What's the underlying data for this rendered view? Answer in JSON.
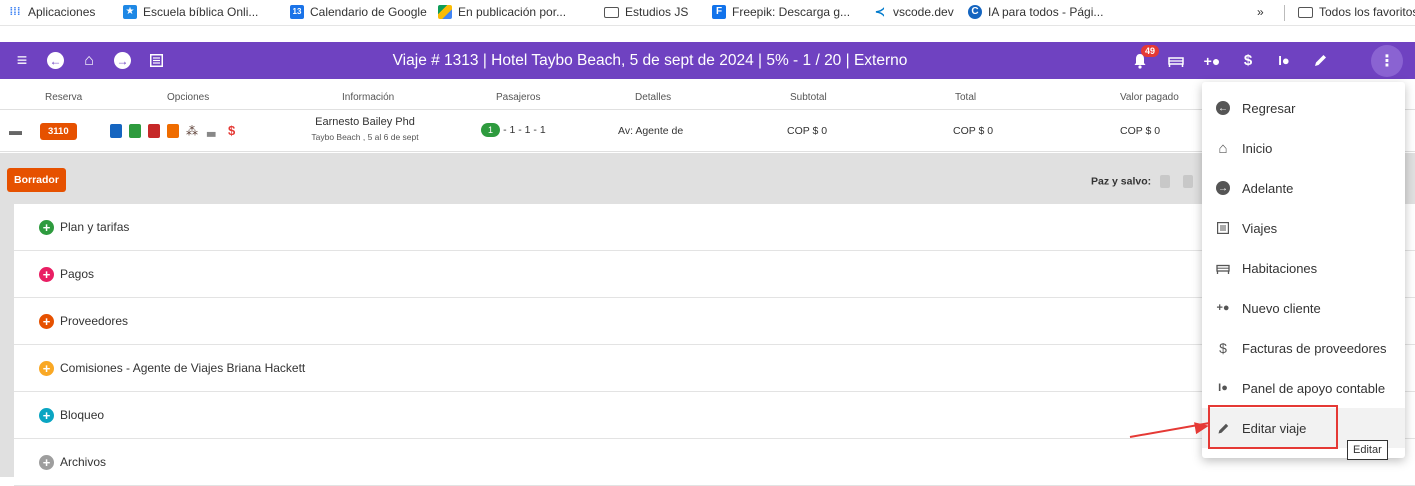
{
  "bookmarks": [
    {
      "label": "Aplicaciones",
      "icon": "apps-grid-icon",
      "color": "#4285f4"
    },
    {
      "label": "Escuela bíblica Onli...",
      "icon": "school-icon",
      "color": "#1e88e5"
    },
    {
      "label": "Calendario de Google",
      "icon": "calendar-icon",
      "color": "#1a73e8"
    },
    {
      "label": "En publicación por...",
      "icon": "drive-icon",
      "color": "#fbbc04"
    },
    {
      "label": "Estudios JS",
      "icon": "folder-icon",
      "color": "#555555"
    },
    {
      "label": "Freepik: Descarga g...",
      "icon": "freepik-icon",
      "color": "#1273eb"
    },
    {
      "label": "vscode.dev",
      "icon": "vscode-icon",
      "color": "#007acc"
    },
    {
      "label": "IA para todos - Pági...",
      "icon": "globe-icon",
      "color": "#1565c0"
    }
  ],
  "bookmarks_more": "»",
  "bookmarks_all": "Todos los favoritos",
  "appbar": {
    "title": "Viaje # 1313 | Hotel Taybo Beach, 5 de sept de 2024 | 5% - 1 / 20 | Externo",
    "notifications_count": "49",
    "bg_color": "#6f42c1"
  },
  "table": {
    "headers": [
      "Reserva",
      "Opciones",
      "Información",
      "Pasajeros",
      "Detalles",
      "Subtotal",
      "Total",
      "Valor pagado"
    ],
    "row": {
      "reserva": "3110",
      "info_name": "Earnesto Bailey Phd",
      "info_sub": "Taybo Beach , 5 al 6 de sept",
      "pax_pill": "1",
      "pax_rest": "- 1 - 1 - 1",
      "detalles": "Av: Agente de",
      "subtotal": "COP $ 0",
      "total": "COP $ 0",
      "valor_pagado": "COP $ 0",
      "dollar": "$"
    }
  },
  "status_badge": "Borrador",
  "paz_y_salvo": "Paz y salvo:",
  "accordion": [
    {
      "label": "Plan y tarifas",
      "color": "#2e9b3e"
    },
    {
      "label": "Pagos",
      "color": "#e91e63"
    },
    {
      "label": "Proveedores",
      "color": "#e65100"
    },
    {
      "label": "Comisiones - Agente de Viajes Briana Hackett",
      "color": "#f9a825"
    },
    {
      "label": "Bloqueo",
      "color": "#0aa5c2"
    },
    {
      "label": "Archivos",
      "color": "#9e9e9e"
    }
  ],
  "menu": [
    {
      "label": "Regresar",
      "icon": "arrow-left-circle-icon"
    },
    {
      "label": "Inicio",
      "icon": "home-icon"
    },
    {
      "label": "Adelante",
      "icon": "arrow-right-circle-icon"
    },
    {
      "label": "Viajes",
      "icon": "list-icon"
    },
    {
      "label": "Habitaciones",
      "icon": "bed-icon"
    },
    {
      "label": "Nuevo cliente",
      "icon": "add-user-icon"
    },
    {
      "label": "Facturas de proveedores",
      "icon": "dollar-icon"
    },
    {
      "label": "Panel de apoyo contable",
      "icon": "support-icon"
    },
    {
      "label": "Editar viaje",
      "icon": "pencil-icon"
    }
  ],
  "tooltip": "Editar"
}
